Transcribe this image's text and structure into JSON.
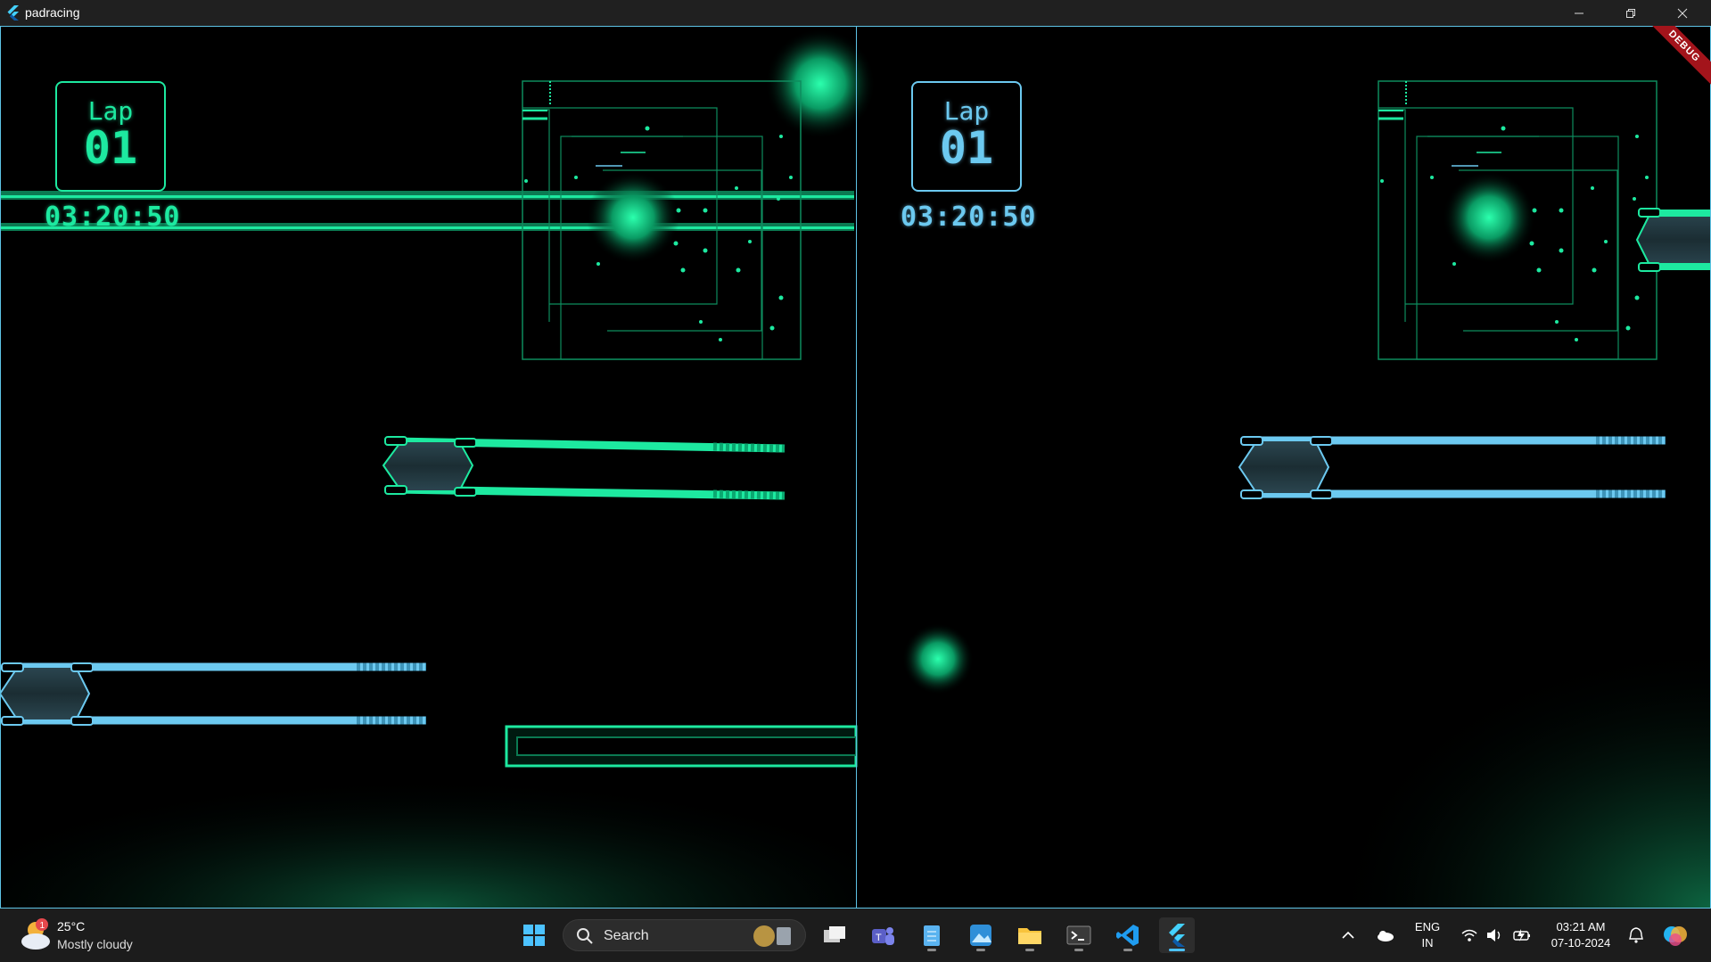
{
  "window": {
    "title": "padracing",
    "controls": [
      "minimize",
      "restore",
      "close"
    ]
  },
  "debug_banner": "DEBUG",
  "players": [
    {
      "lap_label": "Lap",
      "lap_number": "01",
      "timer": "03:20:50",
      "color": "#1de9a0"
    },
    {
      "lap_label": "Lap",
      "lap_number": "01",
      "timer": "03:20:50",
      "color": "#6cc9f0"
    }
  ],
  "colors": {
    "player1": "#1de9a0",
    "player2": "#6cc9f0",
    "panel_border": "#5ec4e6",
    "debug": "#a3141b"
  },
  "taskbar": {
    "weather": {
      "badge": "1",
      "temp": "25°C",
      "condition": "Mostly cloudy"
    },
    "search_label": "Search",
    "apps": [
      "start-icon",
      "task-view-icon",
      "teams-icon",
      "notepad-icon",
      "photos-icon",
      "file-explorer-icon",
      "terminal-icon",
      "vscode-icon",
      "flutter-icon"
    ],
    "tray": {
      "lang_line1": "ENG",
      "lang_line2": "IN",
      "time": "03:21 AM",
      "date": "07-10-2024"
    }
  }
}
